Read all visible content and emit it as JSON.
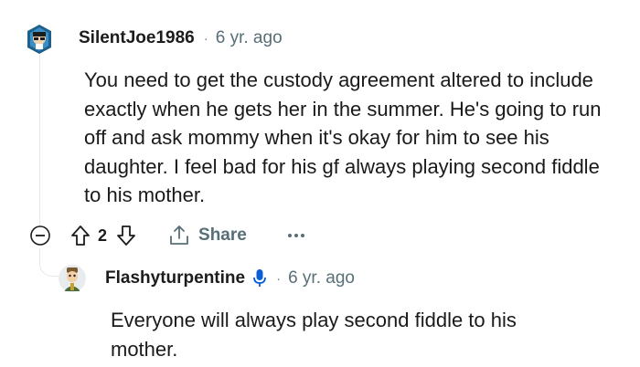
{
  "comment": {
    "username": "SilentJoe1986",
    "separator": "·",
    "age": "6 yr. ago",
    "body": "You need to get the custody agreement altered to include exactly when he gets her in the summer. He's going to run off and ask mommy when it's okay for him to see his daughter. I feel bad for his gf always playing second fiddle to his mother.",
    "actions": {
      "vote_count": "2",
      "share_label": "Share",
      "more_label": "···"
    },
    "colors": {
      "meta_gray": "#576f76",
      "line": "#e5e7eb",
      "text": "#1a1a1b",
      "mic_blue": "#0a5fd6"
    }
  },
  "reply": {
    "username": "Flashyturpentine",
    "badge_icon": "microphone-icon",
    "separator": "·",
    "age": "6 yr. ago",
    "body": "Everyone will always play second fiddle to his mother."
  }
}
